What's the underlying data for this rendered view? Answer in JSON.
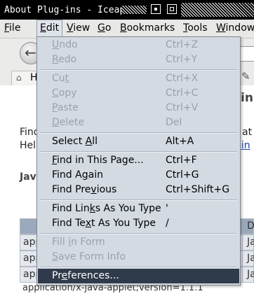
{
  "window": {
    "title": "About Plug-ins - Iceape"
  },
  "menubar": {
    "items": [
      {
        "id": "file",
        "label_pre": "",
        "label_u": "F",
        "label_post": "ile"
      },
      {
        "id": "edit",
        "label_pre": "",
        "label_u": "E",
        "label_post": "dit"
      },
      {
        "id": "view",
        "label_pre": "",
        "label_u": "V",
        "label_post": "iew"
      },
      {
        "id": "go",
        "label_pre": "",
        "label_u": "G",
        "label_post": "o"
      },
      {
        "id": "bookmarks",
        "label_pre": "",
        "label_u": "B",
        "label_post": "ookmarks"
      },
      {
        "id": "tools",
        "label_pre": "",
        "label_u": "T",
        "label_post": "ools"
      },
      {
        "id": "window",
        "label_pre": "",
        "label_u": "W",
        "label_post": "indow"
      }
    ]
  },
  "tabs": {
    "home_label": "H"
  },
  "page": {
    "heading": "in",
    "text1": "Find",
    "text1_right": "at",
    "text2": "Hel",
    "link": "gin",
    "java_label": "Java",
    "table": {
      "rows": [
        {
          "c1": "app",
          "c2": "Ja"
        },
        {
          "c1": "app",
          "c2": "Ja"
        },
        {
          "c1": "app",
          "c2": "Ja"
        }
      ],
      "header_right": "D",
      "last_line": "application/x-java-applet;version=1.1.1"
    }
  },
  "edit_menu": {
    "undo": {
      "pre": "",
      "u": "U",
      "post": "ndo",
      "shortcut": "Ctrl+Z"
    },
    "redo": {
      "pre": "",
      "u": "R",
      "post": "edo",
      "shortcut": "Ctrl+Y"
    },
    "cut": {
      "pre": "Cu",
      "u": "t",
      "post": "",
      "shortcut": "Ctrl+X"
    },
    "copy": {
      "pre": "",
      "u": "C",
      "post": "opy",
      "shortcut": "Ctrl+C"
    },
    "paste": {
      "pre": "",
      "u": "P",
      "post": "aste",
      "shortcut": "Ctrl+V"
    },
    "delete": {
      "pre": "",
      "u": "D",
      "post": "elete",
      "shortcut": "Del"
    },
    "select_all": {
      "pre": "Select ",
      "u": "A",
      "post": "ll",
      "shortcut": "Alt+A"
    },
    "find_in_page": {
      "pre": "",
      "u": "F",
      "post": "ind in This Page...",
      "shortcut": "Ctrl+F"
    },
    "find_again": {
      "pre": "Find A",
      "u": "g",
      "post": "ain",
      "shortcut": "Ctrl+G"
    },
    "find_previous": {
      "pre": "Find Pre",
      "u": "v",
      "post": "ious",
      "shortcut": "Ctrl+Shift+G"
    },
    "find_links": {
      "pre": "Find Lin",
      "u": "k",
      "post": "s As You Type",
      "shortcut": "'"
    },
    "find_text": {
      "pre": "Find Te",
      "u": "x",
      "post": "t As You Type",
      "shortcut": "/"
    },
    "fill_in_form": {
      "pre": "Fill ",
      "u": "i",
      "post": "n Form",
      "shortcut": ""
    },
    "save_form_info": {
      "pre": "",
      "u": "S",
      "post": "ave Form Info",
      "shortcut": ""
    },
    "preferences": {
      "pre": "Pr",
      "u": "e",
      "post": "ferences...",
      "shortcut": ""
    }
  },
  "colors": {
    "menu_bg": "#d4dae2",
    "highlight": "#2f3a4a",
    "disabled_text": "#9aa1a9"
  }
}
